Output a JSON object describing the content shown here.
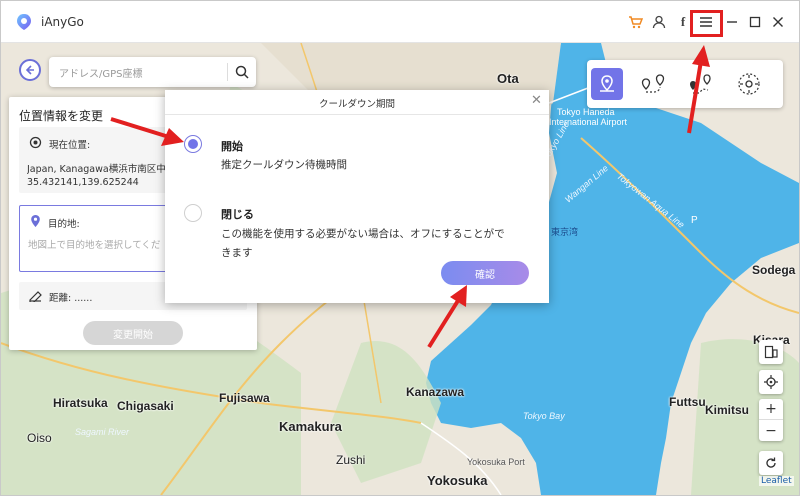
{
  "window": {
    "app_name": "iAnyGo"
  },
  "search": {
    "placeholder": "アドレス/GPS座標"
  },
  "panel": {
    "title": "位置情報を変更",
    "current_label": "現在位置:",
    "current_address": "Japan, Kanagawa横浜市南区中",
    "current_coords": "35.432141,139.625244",
    "destination_label": "目的地:",
    "destination_hint": "地図上で目的地を選択してくだ",
    "distance_label": "距離: ......",
    "start_button": "変更開始"
  },
  "dialog": {
    "title": "クールダウン期間",
    "option_on_title": "開始",
    "option_on_desc": "推定クールダウン待機時間",
    "option_off_title": "閉じる",
    "option_off_desc_1": "この機能を使用する必要がない場合は、オフにすることがで",
    "option_off_desc_2": "きます",
    "confirm_button": "確認",
    "selected": "開始"
  },
  "map": {
    "labels": {
      "ota": "Ota",
      "tokyo_haneda": "Tokyo Haneda",
      "intl_airport": "International Airport",
      "tokyowan_aqua": "Tokyowan Aqua Line",
      "tokyo_bay_jp": "東京湾",
      "sodega": "Sodega",
      "kisarazu": "Kisara",
      "kanazawa": "Kanazawa",
      "tokyo_bay": "Tokyo Bay",
      "hiratsuka": "Hiratsuka",
      "chigasaki": "Chigasaki",
      "fujisawa": "Fujisawa",
      "kamakura": "Kamakura",
      "futtsu": "Futtsu",
      "kimitsu": "Kimitsu",
      "oiso": "Oiso",
      "sagami_river": "Sagami River",
      "zushi": "Zushi",
      "yokosuka_port": "Yokosuka Port",
      "yokosuka": "Yokosuka",
      "ikebukuro_line": "Tokyo Line",
      "bayshore": "Wangan Line",
      "p": "P"
    },
    "attribution": "Leaflet"
  },
  "colors": {
    "accent": "#7274e8",
    "water": "#4fb4e8",
    "annotation": "#e22020"
  }
}
